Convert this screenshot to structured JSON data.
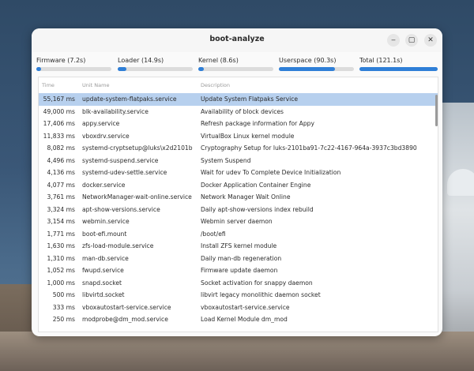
{
  "window": {
    "title": "boot-analyze",
    "controls": {
      "minimize": "‒",
      "maximize": "▢",
      "close": "✕"
    }
  },
  "progress": [
    {
      "label": "Firmware (7.2s)",
      "fraction": 0.06
    },
    {
      "label": "Loader (14.9s)",
      "fraction": 0.12
    },
    {
      "label": "Kernel (8.6s)",
      "fraction": 0.07
    },
    {
      "label": "Userspace (90.3s)",
      "fraction": 0.75
    },
    {
      "label": "Total (121.1s)",
      "fraction": 1.0
    }
  ],
  "accent_color": "#2f7fd7",
  "selection_color": "#b7d0ee",
  "table": {
    "headers": {
      "time": "Time",
      "unit": "Unit Name",
      "desc": "Description"
    },
    "rows": [
      {
        "time": "55,167 ms",
        "unit": "update-system-flatpaks.service",
        "desc": "Update System Flatpaks Service",
        "selected": true
      },
      {
        "time": "49,000 ms",
        "unit": "blk-availability.service",
        "desc": "Availability of block devices"
      },
      {
        "time": "17,406 ms",
        "unit": "appy.service",
        "desc": "Refresh package information for Appy"
      },
      {
        "time": "11,833 ms",
        "unit": "vboxdrv.service",
        "desc": "VirtualBox Linux kernel module"
      },
      {
        "time": "8,082 ms",
        "unit": "systemd-cryptsetup@luks\\x2d2101b",
        "desc": "Cryptography Setup for luks-2101ba91-7c22-4167-964a-3937c3bd3890"
      },
      {
        "time": "4,496 ms",
        "unit": "systemd-suspend.service",
        "desc": "System Suspend"
      },
      {
        "time": "4,136 ms",
        "unit": "systemd-udev-settle.service",
        "desc": "Wait for udev To Complete Device Initialization"
      },
      {
        "time": "4,077 ms",
        "unit": "docker.service",
        "desc": "Docker Application Container Engine"
      },
      {
        "time": "3,761 ms",
        "unit": "NetworkManager-wait-online.service",
        "desc": "Network Manager Wait Online"
      },
      {
        "time": "3,324 ms",
        "unit": "apt-show-versions.service",
        "desc": "Daily apt-show-versions index rebuild"
      },
      {
        "time": "3,154 ms",
        "unit": "webmin.service",
        "desc": "Webmin server daemon"
      },
      {
        "time": "1,771 ms",
        "unit": "boot-efi.mount",
        "desc": "/boot/efi"
      },
      {
        "time": "1,630 ms",
        "unit": "zfs-load-module.service",
        "desc": "Install ZFS kernel module"
      },
      {
        "time": "1,310 ms",
        "unit": "man-db.service",
        "desc": "Daily man-db regeneration"
      },
      {
        "time": "1,052 ms",
        "unit": "fwupd.service",
        "desc": "Firmware update daemon"
      },
      {
        "time": "1,000 ms",
        "unit": "snapd.socket",
        "desc": "Socket activation for snappy daemon"
      },
      {
        "time": "500 ms",
        "unit": "libvirtd.socket",
        "desc": "libvirt legacy monolithic daemon socket"
      },
      {
        "time": "333 ms",
        "unit": "vboxautostart-service.service",
        "desc": "vboxautostart-service.service"
      },
      {
        "time": "250 ms",
        "unit": "modprobe@dm_mod.service",
        "desc": "Load Kernel Module dm_mod"
      }
    ]
  }
}
